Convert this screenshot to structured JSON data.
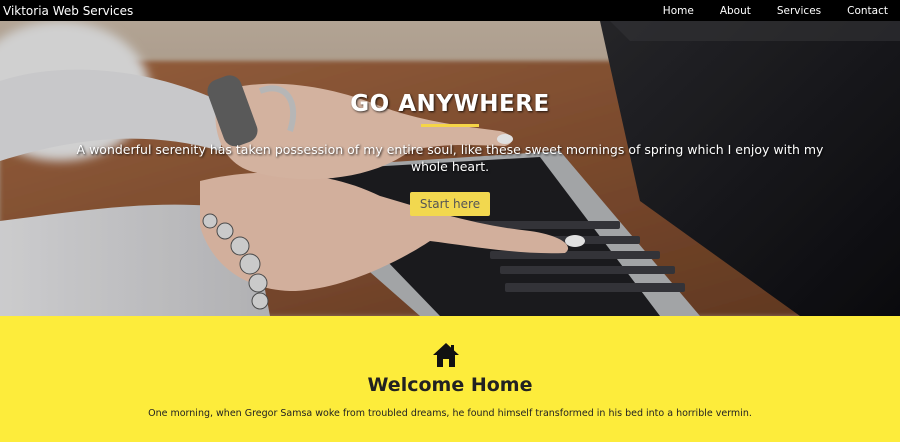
{
  "navbar": {
    "brand": "Viktoria Web Services",
    "links": [
      "Home",
      "About",
      "Services",
      "Contact"
    ]
  },
  "hero": {
    "title": "GO ANYWHERE",
    "text": "A wonderful serenity has taken possession of my entire soul, like these sweet mornings of spring which I enjoy with my whole heart.",
    "button_label": "Start here"
  },
  "welcome": {
    "icon": "home-icon",
    "title": "Welcome Home",
    "text": "One morning, when Gregor Samsa woke from troubled dreams, he found himself transformed in his bed into a horrible vermin."
  },
  "colors": {
    "navbar_bg": "#000000",
    "accent_yellow": "#f5d547",
    "button_bg": "#f2d84f",
    "section_bg": "#fdec3b"
  }
}
